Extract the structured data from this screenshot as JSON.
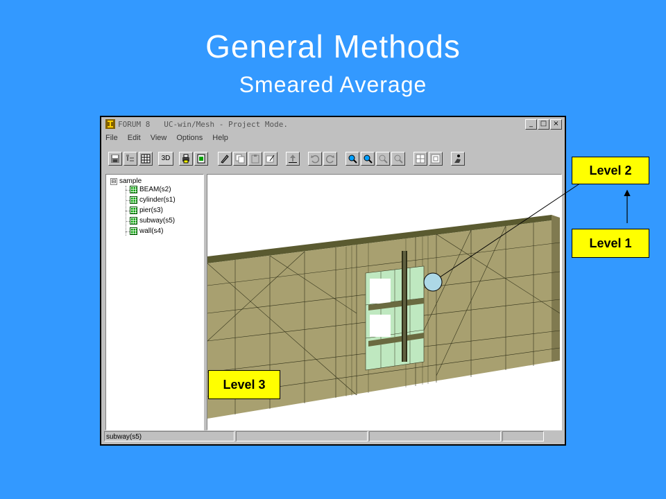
{
  "slide": {
    "title": "General Methods",
    "subtitle": "Smeared Average",
    "background": "#3399ff"
  },
  "window": {
    "title": "FORUM 8   UC-win/Mesh - Project Mode.",
    "controls": [
      "_",
      "□",
      "×"
    ],
    "menu": [
      "File",
      "Edit",
      "View",
      "Options",
      "Help"
    ],
    "toolbar_3d_label": "3D"
  },
  "tree": {
    "root": "sample",
    "expander": "⊟",
    "items": [
      "BEAM(s2)",
      "cylinder(s1)",
      "pier(s3)",
      "subway(s5)",
      "wall(s4)"
    ]
  },
  "status": {
    "selected": "subway(s5)"
  },
  "callouts": {
    "level1": "Level 1",
    "level2": "Level 2",
    "level3": "Level 3",
    "color": "#ffff00"
  }
}
